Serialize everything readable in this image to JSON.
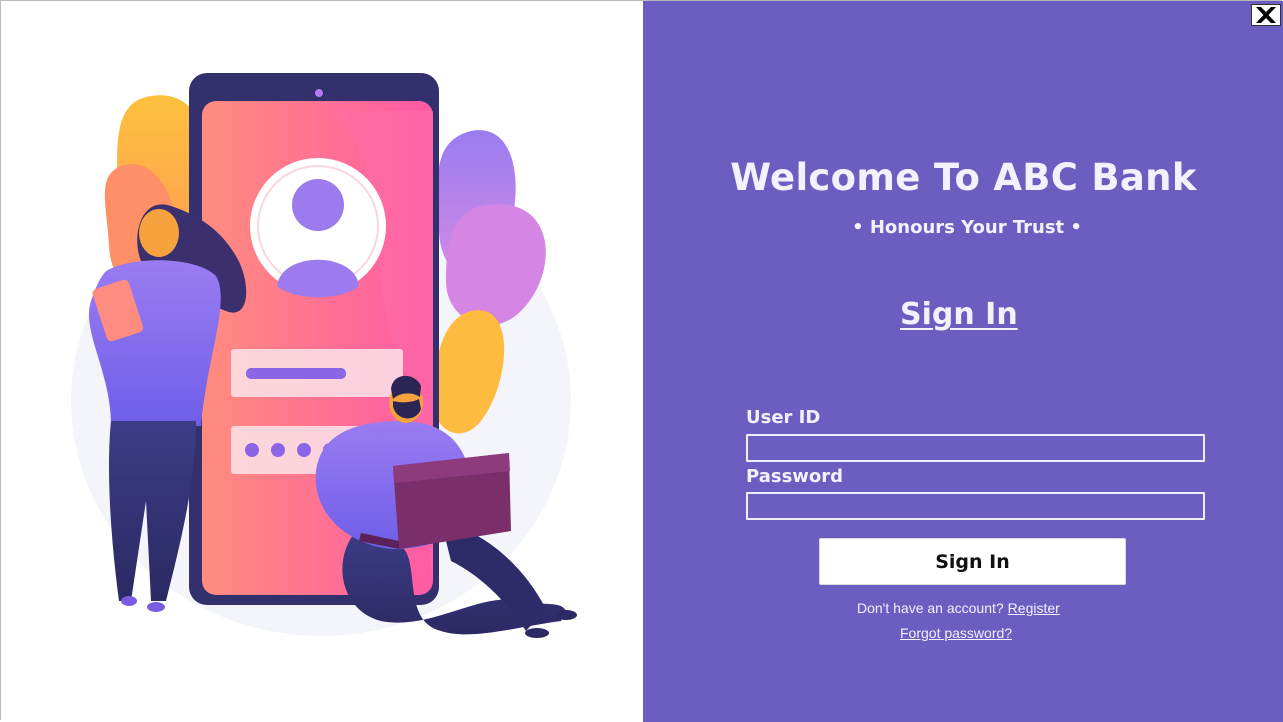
{
  "window": {
    "close_icon": "close-x-icon"
  },
  "illustration": {
    "icon": "phone-login-people-illustration",
    "colors": {
      "phone": "#34306e",
      "screen_from": "#ff8a80",
      "screen_to": "#ff5fa2",
      "accent": "#8b6cf0",
      "leaf_orange": "#fcbf3e",
      "leaf_purple": "#b480ea"
    }
  },
  "login": {
    "title": "Welcome To ABC Bank",
    "tagline": "• Honours Your Trust •",
    "heading": "Sign In",
    "user_id_label": "User ID",
    "user_id_value": "",
    "password_label": "Password",
    "password_value": "",
    "submit_label": "Sign In",
    "no_account_text": "Don't have an account?",
    "register_link": "Register",
    "forgot_link": "Forgot password?",
    "background_color": "#6c5ec1"
  }
}
